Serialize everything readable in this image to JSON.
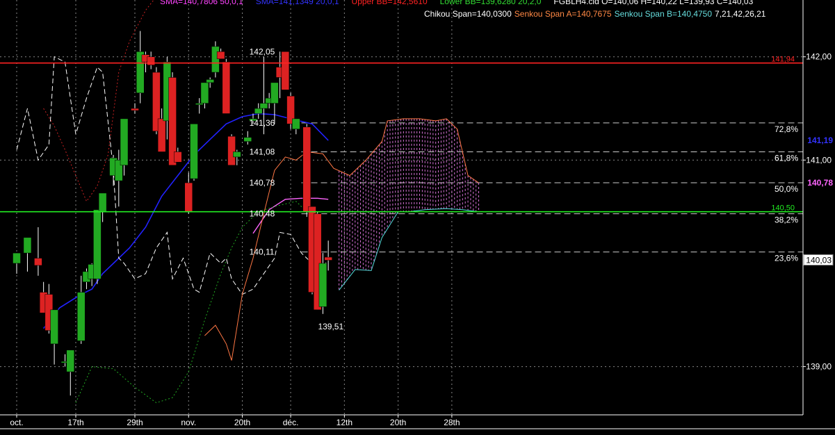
{
  "header": {
    "line1": [
      {
        "text": "SMA=140,7806  50,0,1",
        "color": "#ff44ff"
      },
      {
        "text": "SMA=141,1349  20,0,1",
        "color": "#3333ff"
      },
      {
        "text": "Upper BB=142,5610",
        "color": "#ff2222"
      },
      {
        "text": "Lower BB=139,6280  20,2,0",
        "color": "#33dd33"
      },
      {
        "text": "FGBLH4.cld O=140,06 H=140,22 L=139,93 C=140,03",
        "color": "#ffffff"
      }
    ],
    "line2": [
      {
        "text": "Chikou Span=140,0300",
        "color": "#ffffff"
      },
      {
        "text": "Senkou Span A=140,7675",
        "color": "#ff8844"
      },
      {
        "text": "Senkou Span B=140,4750",
        "color": "#66dddd"
      },
      {
        "text": "7,21,42,26,21",
        "color": "#ffffff"
      }
    ]
  },
  "colors": {
    "background": "#000000",
    "bull_candle": "#22aa22",
    "bear_candle": "#dd2222",
    "wick": "#ffffff",
    "sma20": "#2222ff",
    "sma50": "#ff66ff",
    "chikou": "#ffffff",
    "senkou_a": "#ff7744",
    "senkou_b": "#55dddd",
    "cloud_fill": "#ff88ff",
    "upper_bb": "#cc2222",
    "lower_bb": "#22aa22",
    "resistance": "#ff2222",
    "support": "#22ee22",
    "grid": "#888888"
  },
  "chart_data": {
    "type": "candlestick",
    "symbol": "FGBLH4",
    "title": "",
    "ylim": [
      138.58,
      142.55
    ],
    "y_ticks": [
      {
        "value": 142.0,
        "label": "142,00"
      },
      {
        "value": 141.0,
        "label": "141,00"
      },
      {
        "value": 139.0,
        "label": "139,00"
      }
    ],
    "x_tick_labels": [
      {
        "index": 0,
        "label": "oct."
      },
      {
        "index": 11,
        "label": "17th"
      },
      {
        "index": 22,
        "label": "29th"
      },
      {
        "index": 32,
        "label": "nov."
      },
      {
        "index": 42,
        "label": "20th"
      },
      {
        "index": 51,
        "label": "déc."
      },
      {
        "index": 61,
        "label": "12th"
      },
      {
        "index": 71,
        "label": "20th"
      },
      {
        "index": 81,
        "label": "28th"
      }
    ],
    "candles": [
      {
        "i": 0,
        "o": 140.0,
        "h": 140.1,
        "l": 139.9,
        "c": 140.1
      },
      {
        "i": 2,
        "o": 140.1,
        "h": 140.2,
        "l": 139.92,
        "c": 140.25
      },
      {
        "i": 4,
        "o": 140.05,
        "h": 140.35,
        "l": 139.88,
        "c": 139.98
      },
      {
        "i": 5,
        "o": 139.72,
        "h": 139.82,
        "l": 139.54,
        "c": 139.52
      },
      {
        "i": 6,
        "o": 139.7,
        "h": 139.8,
        "l": 139.32,
        "c": 139.35
      },
      {
        "i": 7,
        "o": 139.22,
        "h": 139.55,
        "l": 139.02,
        "c": 139.55
      },
      {
        "i": 9,
        "o": 139.05,
        "h": 139.12,
        "l": 139.0,
        "c": 139.05
      },
      {
        "i": 10,
        "o": 138.95,
        "h": 139.1,
        "l": 138.72,
        "c": 139.16
      },
      {
        "i": 12,
        "o": 139.25,
        "h": 139.88,
        "l": 139.22,
        "c": 139.72
      },
      {
        "i": 13,
        "o": 139.82,
        "h": 139.95,
        "l": 139.75,
        "c": 139.92
      },
      {
        "i": 14,
        "o": 139.85,
        "h": 140.0,
        "l": 139.78,
        "c": 139.99
      },
      {
        "i": 15,
        "o": 139.85,
        "h": 140.52,
        "l": 139.8,
        "c": 140.52
      },
      {
        "i": 16,
        "o": 140.5,
        "h": 140.65,
        "l": 140.4,
        "c": 140.68
      },
      {
        "i": 18,
        "o": 140.85,
        "h": 141.05,
        "l": 140.75,
        "c": 141.02
      },
      {
        "i": 19,
        "o": 140.8,
        "h": 141.1,
        "l": 140.55,
        "c": 141.0
      },
      {
        "i": 20,
        "o": 140.95,
        "h": 141.35,
        "l": 140.85,
        "c": 141.4
      },
      {
        "i": 22,
        "o": 141.5,
        "h": 141.55,
        "l": 141.45,
        "c": 141.48
      },
      {
        "i": 23,
        "o": 141.65,
        "h": 142.25,
        "l": 141.55,
        "c": 142.05
      },
      {
        "i": 24,
        "o": 142.02,
        "h": 142.05,
        "l": 141.85,
        "c": 141.95
      },
      {
        "i": 25,
        "o": 142.0,
        "h": 142.05,
        "l": 141.88,
        "c": 141.92
      },
      {
        "i": 26,
        "o": 141.85,
        "h": 141.9,
        "l": 141.25,
        "c": 141.28
      },
      {
        "i": 27,
        "o": 141.4,
        "h": 141.5,
        "l": 141.3,
        "c": 141.08
      },
      {
        "i": 28,
        "o": 141.38,
        "h": 142.0,
        "l": 141.2,
        "c": 141.95
      },
      {
        "i": 29,
        "o": 141.8,
        "h": 141.85,
        "l": 140.95,
        "c": 140.95
      },
      {
        "i": 30,
        "o": 141.08,
        "h": 141.12,
        "l": 140.98,
        "c": 140.98
      },
      {
        "i": 32,
        "o": 140.78,
        "h": 140.88,
        "l": 140.48,
        "c": 140.5
      },
      {
        "i": 33,
        "o": 140.82,
        "h": 141.35,
        "l": 140.8,
        "c": 141.35
      },
      {
        "i": 34,
        "o": 141.55,
        "h": 141.6,
        "l": 141.45,
        "c": 141.55
      },
      {
        "i": 35,
        "o": 141.55,
        "h": 141.75,
        "l": 141.5,
        "c": 141.75
      },
      {
        "i": 36,
        "o": 141.75,
        "h": 141.8,
        "l": 141.7,
        "c": 141.78
      },
      {
        "i": 37,
        "o": 141.85,
        "h": 142.15,
        "l": 141.8,
        "c": 142.1
      },
      {
        "i": 38,
        "o": 142.05,
        "h": 142.08,
        "l": 141.98,
        "c": 141.98
      },
      {
        "i": 39,
        "o": 141.95,
        "h": 141.98,
        "l": 141.45,
        "c": 141.45
      },
      {
        "i": 40,
        "o": 141.23,
        "h": 141.25,
        "l": 140.95,
        "c": 140.95
      },
      {
        "i": 41,
        "o": 141.03,
        "h": 141.1,
        "l": 140.95,
        "c": 141.08
      },
      {
        "i": 43,
        "o": 141.18,
        "h": 141.28,
        "l": 141.15,
        "c": 141.22
      },
      {
        "i": 44,
        "o": 141.38,
        "h": 141.45,
        "l": 141.35,
        "c": 141.4
      },
      {
        "i": 45,
        "o": 141.45,
        "h": 141.55,
        "l": 141.4,
        "c": 141.5
      },
      {
        "i": 46,
        "o": 141.5,
        "h": 142.0,
        "l": 141.25,
        "c": 141.55
      },
      {
        "i": 47,
        "o": 141.55,
        "h": 141.65,
        "l": 141.5,
        "c": 141.6
      },
      {
        "i": 48,
        "o": 141.55,
        "h": 141.7,
        "l": 141.35,
        "c": 141.75
      },
      {
        "i": 49,
        "o": 141.9,
        "h": 142.05,
        "l": 141.6,
        "c": 141.8
      },
      {
        "i": 50,
        "o": 142.05,
        "h": 142.05,
        "l": 141.75,
        "c": 141.68
      },
      {
        "i": 51,
        "o": 141.62,
        "h": 141.65,
        "l": 141.3,
        "c": 141.35
      },
      {
        "i": 52,
        "o": 141.3,
        "h": 141.4,
        "l": 141.25,
        "c": 141.4
      },
      {
        "i": 54,
        "o": 141.32,
        "h": 141.35,
        "l": 140.45,
        "c": 140.5
      },
      {
        "i": 55,
        "o": 140.55,
        "h": 140.55,
        "l": 139.7,
        "c": 139.72
      },
      {
        "i": 56,
        "o": 140.48,
        "h": 140.5,
        "l": 139.55,
        "c": 139.55
      },
      {
        "i": 57,
        "o": 139.58,
        "h": 140.1,
        "l": 139.51,
        "c": 140.0
      },
      {
        "i": 58,
        "o": 140.06,
        "h": 140.22,
        "l": 139.93,
        "c": 140.03
      }
    ],
    "price_annotations": [
      {
        "label": "142,05",
        "value": 142.05,
        "index": 49
      },
      {
        "label": "141,36",
        "value": 141.36,
        "index": 49
      },
      {
        "label": "141,08",
        "value": 141.08,
        "index": 49
      },
      {
        "label": "140,78",
        "value": 140.78,
        "index": 49
      },
      {
        "label": "140,48",
        "value": 140.48,
        "index": 49
      },
      {
        "label": "140,11",
        "value": 140.11,
        "index": 49
      },
      {
        "label": "139,51",
        "value": 139.51,
        "index": 57
      }
    ],
    "fibonacci_levels": [
      {
        "label": "72,8%",
        "value": 141.36
      },
      {
        "label": "61,8%",
        "value": 141.08
      },
      {
        "label": "50,0%",
        "value": 140.78
      },
      {
        "label": "38,2%",
        "value": 140.48
      },
      {
        "label": "23,6%",
        "value": 140.11
      }
    ],
    "horizontal_lines": [
      {
        "name": "resistance",
        "value": 141.94,
        "label": "141,94"
      },
      {
        "name": "support",
        "value": 140.5,
        "label": "140,50"
      }
    ],
    "right_axis_markers": [
      {
        "label": "141,19",
        "value": 141.19,
        "color": "#3333ff"
      },
      {
        "label": "140,78",
        "value": 140.78,
        "color": "#ff66ff"
      },
      {
        "label": "140,03",
        "value": 140.03,
        "color": "#000000"
      }
    ],
    "series": [
      {
        "name": "SMA 20",
        "points": [
          [
            5,
            139.37
          ],
          [
            8,
            139.57
          ],
          [
            12,
            139.7
          ],
          [
            14,
            139.75
          ],
          [
            16,
            139.9
          ],
          [
            18,
            140.0
          ],
          [
            21,
            140.15
          ],
          [
            24,
            140.35
          ],
          [
            27,
            140.65
          ],
          [
            30,
            140.85
          ],
          [
            33,
            141.05
          ],
          [
            36,
            141.2
          ],
          [
            39,
            141.35
          ],
          [
            42,
            141.42
          ],
          [
            45,
            141.45
          ],
          [
            48,
            141.44
          ],
          [
            51,
            141.4
          ],
          [
            55,
            141.35
          ],
          [
            58,
            141.19
          ]
        ]
      },
      {
        "name": "SMA 50",
        "points": [
          [
            44,
            140.29
          ],
          [
            47,
            140.52
          ],
          [
            50,
            140.62
          ],
          [
            53,
            140.63
          ],
          [
            56,
            140.63
          ],
          [
            58,
            140.62
          ]
        ]
      },
      {
        "name": "Upper BB",
        "points": [
          [
            5,
            141.5
          ],
          [
            7,
            141.33
          ],
          [
            9,
            141.1
          ],
          [
            11,
            140.85
          ],
          [
            13,
            140.6
          ],
          [
            15,
            140.75
          ],
          [
            17,
            141.05
          ],
          [
            19,
            141.85
          ],
          [
            21,
            142.15
          ],
          [
            24,
            142.45
          ],
          [
            27,
            142.65
          ],
          [
            30,
            142.75
          ],
          [
            34,
            142.8
          ],
          [
            38,
            142.78
          ],
          [
            42,
            142.65
          ],
          [
            46,
            142.6
          ],
          [
            50,
            142.63
          ],
          [
            54,
            142.7
          ],
          [
            57,
            142.68
          ]
        ]
      },
      {
        "name": "Lower BB",
        "points": [
          [
            11,
            138.65
          ],
          [
            14,
            139.0
          ],
          [
            18,
            138.98
          ],
          [
            22,
            138.8
          ],
          [
            26,
            138.65
          ],
          [
            29,
            138.7
          ],
          [
            32,
            138.95
          ],
          [
            35,
            139.45
          ],
          [
            38,
            139.9
          ],
          [
            40,
            140.15
          ],
          [
            42,
            140.35
          ],
          [
            45,
            140.5
          ],
          [
            48,
            140.55
          ],
          [
            52,
            140.6
          ],
          [
            54,
            140.5
          ]
        ]
      },
      {
        "name": "Chikou Span",
        "points": [
          [
            0,
            141.1
          ],
          [
            2,
            141.5
          ],
          [
            4,
            141.0
          ],
          [
            6,
            141.15
          ],
          [
            7,
            142.0
          ],
          [
            9,
            141.95
          ],
          [
            11,
            141.25
          ],
          [
            13,
            141.6
          ],
          [
            15,
            141.9
          ],
          [
            16,
            141.85
          ],
          [
            18,
            140.9
          ],
          [
            19,
            140.05
          ],
          [
            20,
            140.0
          ],
          [
            22,
            139.85
          ],
          [
            24,
            139.9
          ],
          [
            26,
            140.15
          ],
          [
            28,
            140.3
          ],
          [
            29,
            139.85
          ],
          [
            31,
            140.05
          ],
          [
            33,
            139.75
          ],
          [
            34,
            139.72
          ],
          [
            36,
            140.1
          ],
          [
            38,
            140.0
          ],
          [
            39,
            140.05
          ],
          [
            40,
            139.85
          ],
          [
            42,
            139.7
          ],
          [
            44,
            139.75
          ],
          [
            46,
            139.9
          ],
          [
            48,
            140.05
          ],
          [
            49,
            140.3
          ],
          [
            51,
            140.28
          ],
          [
            53,
            140.1
          ],
          [
            56,
            139.95
          ],
          [
            57,
            139.97
          ],
          [
            58,
            140.03
          ]
        ]
      },
      {
        "name": "Senkou Span A",
        "points": [
          [
            35,
            139.3
          ],
          [
            37,
            139.4
          ],
          [
            39,
            139.22
          ],
          [
            40,
            139.06
          ],
          [
            42,
            139.7
          ],
          [
            44,
            140.05
          ],
          [
            46,
            140.48
          ],
          [
            48,
            140.9
          ],
          [
            50,
            141.03
          ],
          [
            52,
            141.0
          ],
          [
            54,
            141.08
          ],
          [
            57,
            141.06
          ],
          [
            59,
            140.92
          ],
          [
            62,
            140.85
          ],
          [
            65,
            141.0
          ],
          [
            68,
            141.18
          ],
          [
            69,
            141.38
          ],
          [
            72,
            141.4
          ],
          [
            75,
            141.4
          ],
          [
            78,
            141.38
          ],
          [
            80,
            141.4
          ],
          [
            82,
            141.3
          ],
          [
            84,
            140.85
          ],
          [
            86,
            140.78
          ]
        ]
      },
      {
        "name": "Senkou Span B",
        "points": [
          [
            60,
            139.74
          ],
          [
            63,
            139.94
          ],
          [
            66,
            139.93
          ],
          [
            68,
            140.25
          ],
          [
            71,
            140.5
          ],
          [
            73,
            140.5
          ],
          [
            76,
            140.52
          ],
          [
            80,
            140.53
          ],
          [
            83,
            140.52
          ],
          [
            86,
            140.5
          ]
        ]
      }
    ]
  }
}
